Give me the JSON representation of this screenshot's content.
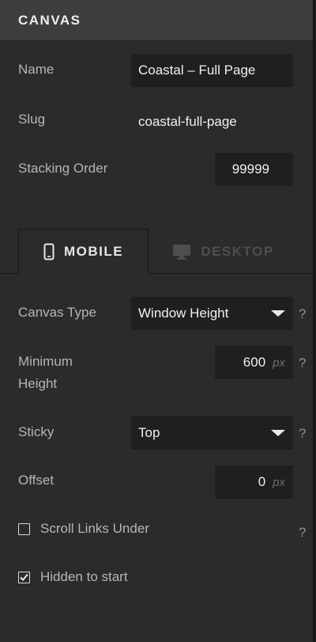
{
  "header": {
    "title": "CANVAS"
  },
  "fields": {
    "name": {
      "label": "Name",
      "value": "Coastal – Full Page"
    },
    "slug": {
      "label": "Slug",
      "value": "coastal-full-page"
    },
    "stacking_order": {
      "label": "Stacking Order",
      "value": "99999"
    }
  },
  "tabs": [
    {
      "label": "MOBILE",
      "icon": "phone-icon",
      "active": true
    },
    {
      "label": "DESKTOP",
      "icon": "monitor-icon",
      "active": false
    }
  ],
  "settings": {
    "canvas_type": {
      "label": "Canvas Type",
      "value": "Window Height",
      "help": "?"
    },
    "min_height": {
      "label_line1": "Minimum",
      "label_line2": "Height",
      "value": "600",
      "unit": "px",
      "help": "?"
    },
    "sticky": {
      "label": "Sticky",
      "value": "Top",
      "help": "?"
    },
    "offset": {
      "label": "Offset",
      "value": "0",
      "unit": "px"
    },
    "scroll_links_under": {
      "label": "Scroll Links Under",
      "checked": false,
      "help": "?"
    },
    "hidden_to_start": {
      "label": "Hidden to start",
      "checked": true
    }
  },
  "colors": {
    "panel_bg": "#2b2b2b",
    "header_bg": "#3d3d3d",
    "field_bg": "#1f1f1f",
    "active_tab_text": "#e6e6e6",
    "inactive_tab_text": "#4e4e4e"
  }
}
